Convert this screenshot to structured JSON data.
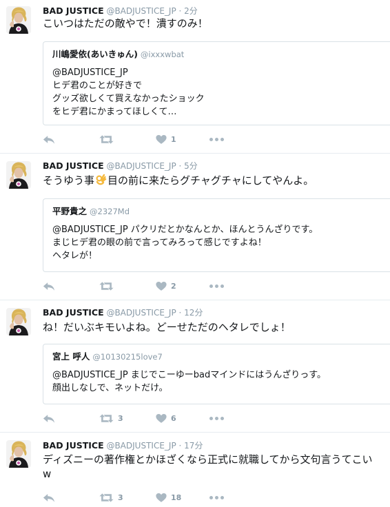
{
  "tweets": [
    {
      "name": "BAD JUSTICE",
      "handle": "@BADJUSTICE_JP",
      "dot": "·",
      "time": "2分",
      "text": "こいつはただの敵やで！潰すのみ！",
      "quote": {
        "name": "川嶋愛依(あいきゅん)",
        "handle": "@ixxxwbat",
        "lines": [
          "@BADJUSTICE_JP",
          "ヒデ君のことが好きで",
          "グッズ欲しくて買えなかったショック",
          "をヒデ君にかまってほしくて…"
        ]
      },
      "retweets": "",
      "likes": "1"
    },
    {
      "name": "BAD JUSTICE",
      "handle": "@BADJUSTICE_JP",
      "dot": "·",
      "time": "5分",
      "text_before": "そうゆう事",
      "text_after": "目の前に来たらグチャグチャにしてやんよ。",
      "quote": {
        "name": "平野貴之",
        "handle": "@2327Md",
        "lines": [
          "@BADJUSTICE_JP パクリだとかなんとか、ほんとうんざりです。",
          "まじヒデ君の眼の前で言ってみろって感じですよね！",
          "ヘタレが！"
        ]
      },
      "retweets": "",
      "likes": "2"
    },
    {
      "name": "BAD JUSTICE",
      "handle": "@BADJUSTICE_JP",
      "dot": "·",
      "time": "12分",
      "text": "ね！だいぶキモいよね。どーせただのヘタレでしょ！",
      "quote": {
        "name": "宮上 呼人",
        "handle": "@10130215love7",
        "lines": [
          "@BADJUSTICE_JP まじでこーゆーbadマインドにはうんざりっす。",
          "顔出しなしで、ネットだけ。"
        ]
      },
      "retweets": "3",
      "likes": "6"
    },
    {
      "name": "BAD JUSTICE",
      "handle": "@BADJUSTICE_JP",
      "dot": "·",
      "time": "17分",
      "text": "ディズニーの著作権とかほざくなら正式に就職してから文句言うてこいw",
      "retweets": "3",
      "likes": "18"
    }
  ],
  "colors": {
    "meta": "#8899a6",
    "icon": "#aab8c2",
    "border": "#e6ecf0",
    "quote_border": "#d9e1e6"
  },
  "icons": [
    "reply-icon",
    "retweet-icon",
    "heart-icon",
    "more-icon",
    "ok-hand-emoji"
  ]
}
